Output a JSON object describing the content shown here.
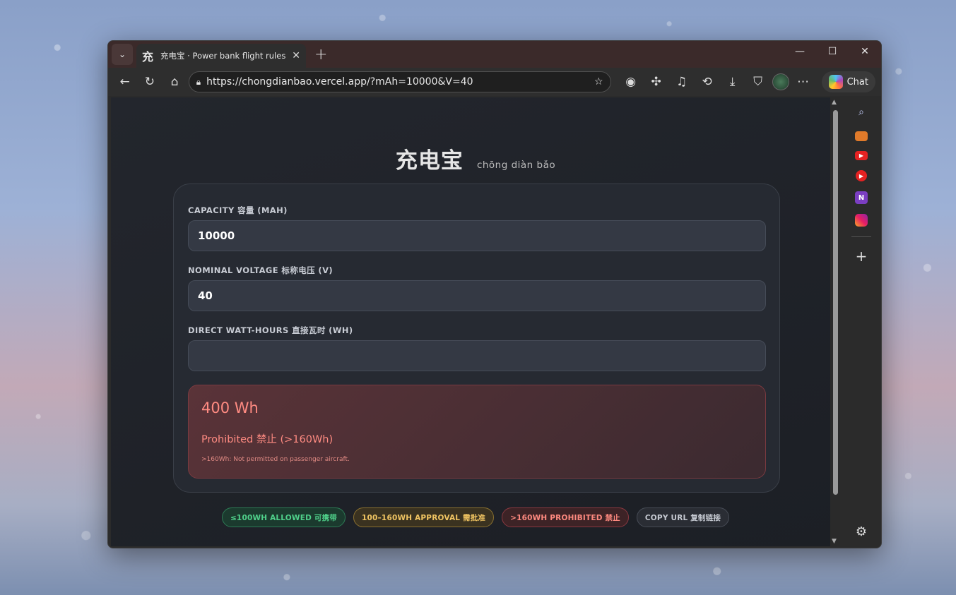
{
  "browser": {
    "tab_title": "充电宝 · Power bank flight rules calculator",
    "tab_favicon": "充",
    "url": "https://chongdianbao.vercel.app/?mAh=10000&V=40",
    "copilot_label": "Chat"
  },
  "page": {
    "title": "充电宝",
    "pinyin": "chōng diàn bǎo",
    "fields": [
      {
        "label": "CAPACITY 容量 (MAH)",
        "value": "10000",
        "placeholder": ""
      },
      {
        "label": "NOMINAL VOLTAGE 标称电压 (V)",
        "value": "40",
        "placeholder": ""
      },
      {
        "label": "DIRECT WATT-HOURS 直接瓦时 (WH)",
        "value": "",
        "placeholder": ""
      }
    ],
    "result": {
      "wh": "400 Wh",
      "status": "Prohibited 禁止 (>160Wh)",
      "note": ">160Wh: Not permitted on passenger aircraft."
    },
    "pills": {
      "allowed": "≤100WH ALLOWED 可携带",
      "approval": "100–160WH APPROVAL 需批准",
      "prohibited": ">160WH PROHIBITED 禁止",
      "copy": "COPY URL 复制链接"
    }
  },
  "colors": {
    "prohibited": "#ff8b82",
    "allowed": "#4fd08a",
    "approval": "#f0c462"
  },
  "icons": {
    "sidebar": [
      "search-icon",
      "briefcase-icon",
      "youtube-icon",
      "youtube-music-icon",
      "onenote-icon",
      "instagram-icon",
      "add-icon",
      "settings-icon"
    ]
  }
}
